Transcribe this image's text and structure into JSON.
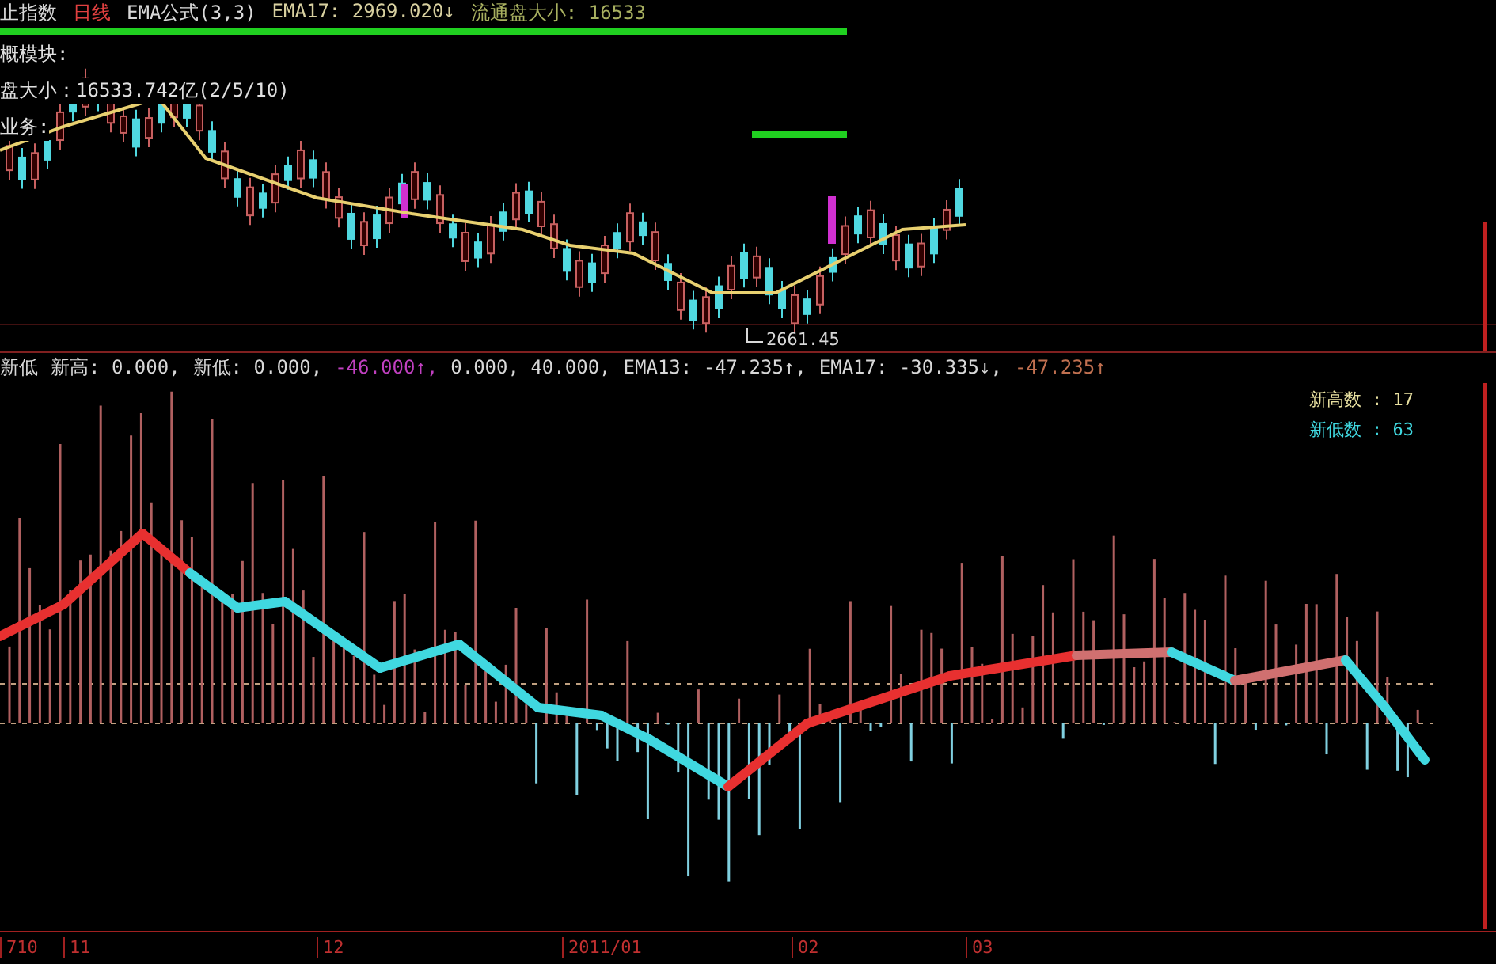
{
  "price_panel": {
    "header": [
      {
        "text": "止指数",
        "color": "#d8d8d8"
      },
      {
        "text": "日线",
        "color": "#e04040"
      },
      {
        "text": "EMA公式(3,3)",
        "color": "#d8d8d8"
      },
      {
        "text": "EMA17: 2969.020↓",
        "color": "#d8d0a0"
      },
      {
        "text": "流通盘大小: 16533",
        "color": "#a8b060"
      }
    ],
    "info_lines": [
      "概模块:",
      "盘大小：16533.742亿(2/5/10)",
      "业务:"
    ],
    "low_label": "2661.45"
  },
  "indicator_panel": {
    "header": [
      {
        "text": "新低",
        "color": "#d8d8d8"
      },
      {
        "text": "新高: 0.000,",
        "color": "#d8d8d8"
      },
      {
        "text": "新低: 0.000,",
        "color": "#d8d8d8"
      },
      {
        "text": "-46.000↑,",
        "color": "#c040c0"
      },
      {
        "text": "0.000, 40.000,",
        "color": "#d8d8d8"
      },
      {
        "text": "EMA13: -47.235↑,",
        "color": "#d8d8d8"
      },
      {
        "text": "EMA17: -30.335↓,",
        "color": "#d8d8d8"
      },
      {
        "text": "-47.235↑",
        "color": "#c07050"
      }
    ],
    "legend": [
      {
        "text": "新高数 : 17",
        "color": "#e8e0a0"
      },
      {
        "text": "新低数 : 63",
        "color": "#40d8e0"
      }
    ]
  },
  "time_axis": [
    "710",
    "11",
    "12",
    "2011/01",
    "02",
    "03"
  ]
}
